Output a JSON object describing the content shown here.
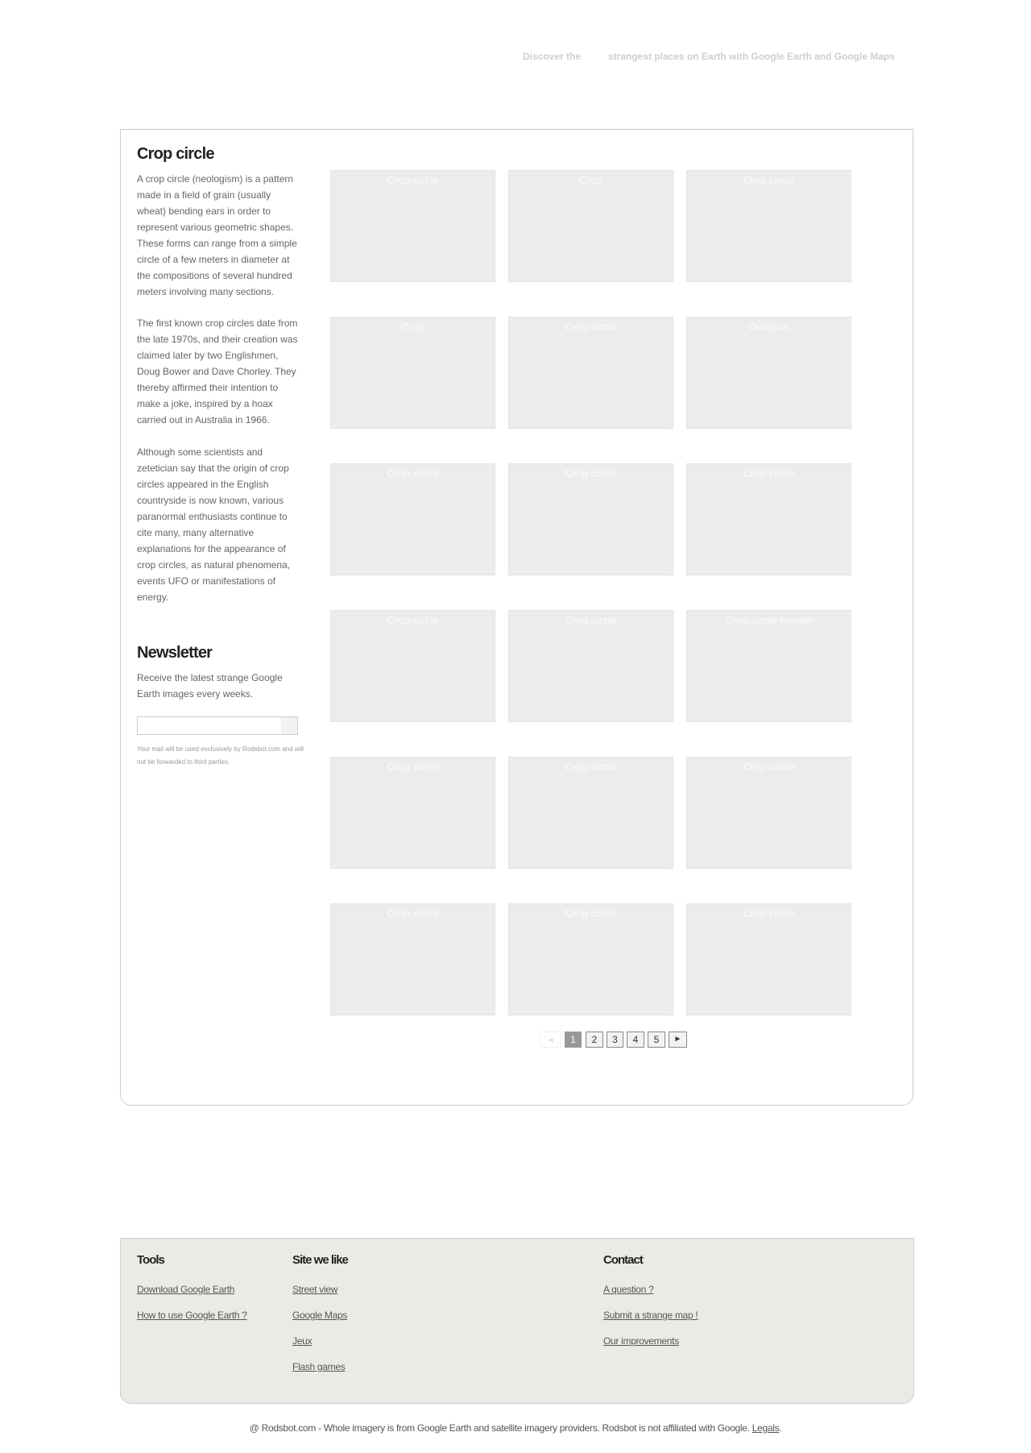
{
  "header": {
    "tagline_part1": "Discover the",
    "tagline_part2": "strangest places on Earth with Google Earth and Google Maps"
  },
  "sidebar": {
    "title": "Crop circle",
    "paragraphs": [
      "A crop circle (neologism) is a pattern made in a field of grain (usually wheat) bending ears in order to represent various geometric shapes. These forms can range from a simple circle of a few meters in diameter at the compositions of several hundred meters involving many sections.",
      "The first known crop circles date from the late 1970s, and their creation was claimed later by two Englishmen, Doug Bower and Dave Chorley. They thereby affirmed their intention to make a joke, inspired by a hoax carried out in Australia in 1966.",
      "Although some scientists and zetetician say that the origin of crop circles appeared in the English countryside is now known, various paranormal enthusiasts continue to cite many, many alternative explanations for the appearance of crop circles, as natural phenomena, events UFO or manifestations of energy."
    ],
    "newsletter": {
      "title": "Newsletter",
      "description": "Receive the latest strange Google Earth images every weeks.",
      "email_value": "",
      "disclaimer": "Your mail will be used exclusively by Rodsbot.com and will not be forwarded to third parties."
    }
  },
  "gallery": {
    "thumbnails": [
      "Crop circle",
      "Crop",
      "Crop circle",
      "Crop",
      "Crop circle",
      "Octopus",
      "Crop circle",
      "Crop circle",
      "Crop circle",
      "Crop circle",
      "Crop circle",
      "Crop circle remain",
      "Crop circle",
      "Crop circle",
      "Crop circle",
      "Crop circle",
      "Crop circle",
      "Crop circle"
    ]
  },
  "pagination": {
    "prev": "◄",
    "pages": [
      "1",
      "2",
      "3",
      "4",
      "5"
    ],
    "current": "1",
    "next": "►"
  },
  "footer": {
    "tools": {
      "title": "Tools",
      "links": [
        "Download Google Earth",
        "How to use Google Earth ?"
      ]
    },
    "sites": {
      "title": "Site we like",
      "links": [
        "Street view",
        "Google Maps",
        "Jeux",
        "Flash games"
      ]
    },
    "contact": {
      "title": "Contact",
      "links": [
        "A question ?",
        "Submit a strange map !",
        "Our improvements"
      ]
    },
    "copyright": "@ Rodsbot.com - Whole imagery is from Google Earth and satellite imagery providers. Rodsbot is not affiliated with Google.",
    "legals_label": "Legals",
    "copyright_end": "."
  },
  "colors": {
    "thumb_bg": "#ececec",
    "footer_bg": "#ebebe6",
    "current_page": "#999999"
  }
}
